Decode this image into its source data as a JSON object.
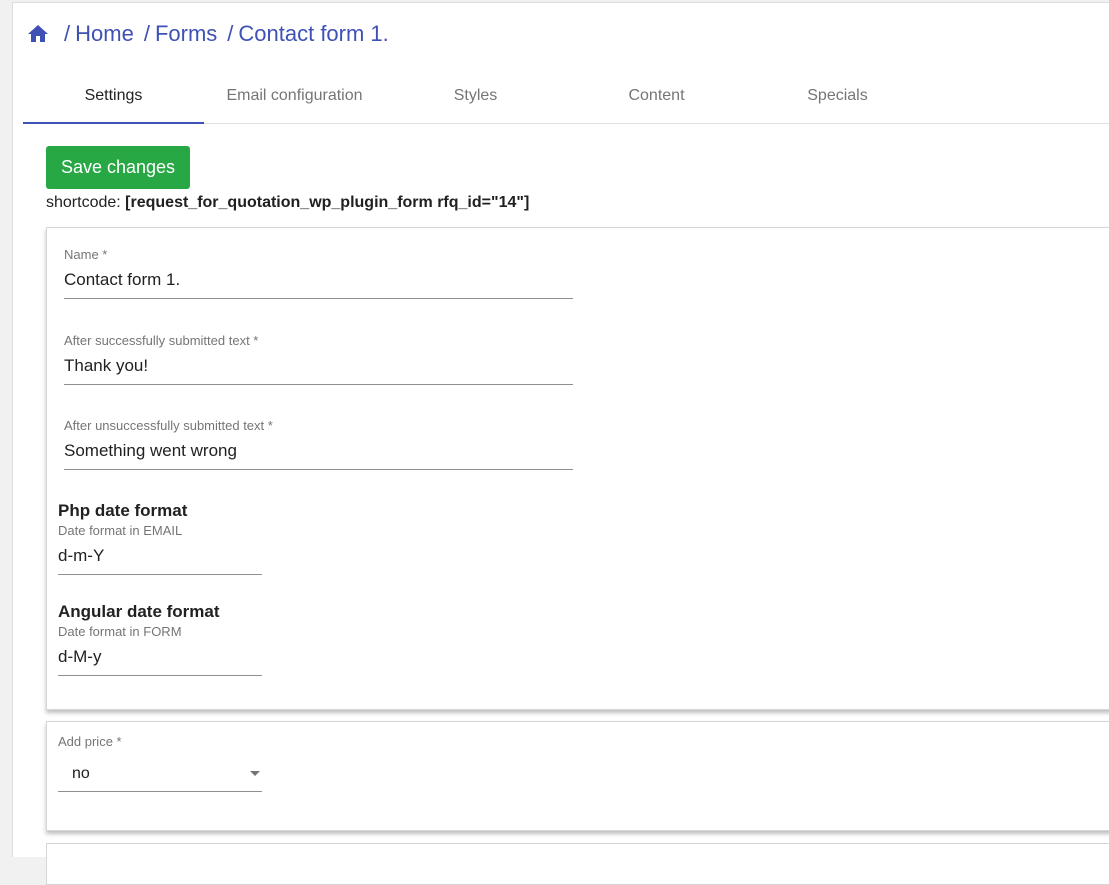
{
  "breadcrumb": {
    "home_icon": "home-icon",
    "items": [
      {
        "sep": "/",
        "label": "Home"
      },
      {
        "sep": "/",
        "label": "Forms"
      },
      {
        "sep": "/",
        "label": "Contact form 1."
      }
    ]
  },
  "tabs": [
    {
      "label": "Settings",
      "active": true
    },
    {
      "label": "Email configuration",
      "active": false
    },
    {
      "label": "Styles",
      "active": false
    },
    {
      "label": "Content",
      "active": false
    },
    {
      "label": "Specials",
      "active": false
    }
  ],
  "toolbar": {
    "save_label": "Save changes"
  },
  "shortcode": {
    "label": "shortcode:",
    "value": "[request_for_quotation_wp_plugin_form rfq_id=\"14\"]"
  },
  "form": {
    "name": {
      "label": "Name *",
      "value": "Contact form 1."
    },
    "success_text": {
      "label": "After successfully submitted text *",
      "value": "Thank you!"
    },
    "fail_text": {
      "label": "After unsuccessfully submitted text *",
      "value": "Something went wrong"
    },
    "php_date": {
      "title": "Php date format",
      "hint": "Date format in EMAIL",
      "value": "d-m-Y"
    },
    "angular_date": {
      "title": "Angular date format",
      "hint": "Date format in FORM",
      "value": "d-M-y"
    }
  },
  "price": {
    "label": "Add price *",
    "selected": "no"
  },
  "colors": {
    "accent": "#3f51b5",
    "save_button": "#28a745"
  }
}
